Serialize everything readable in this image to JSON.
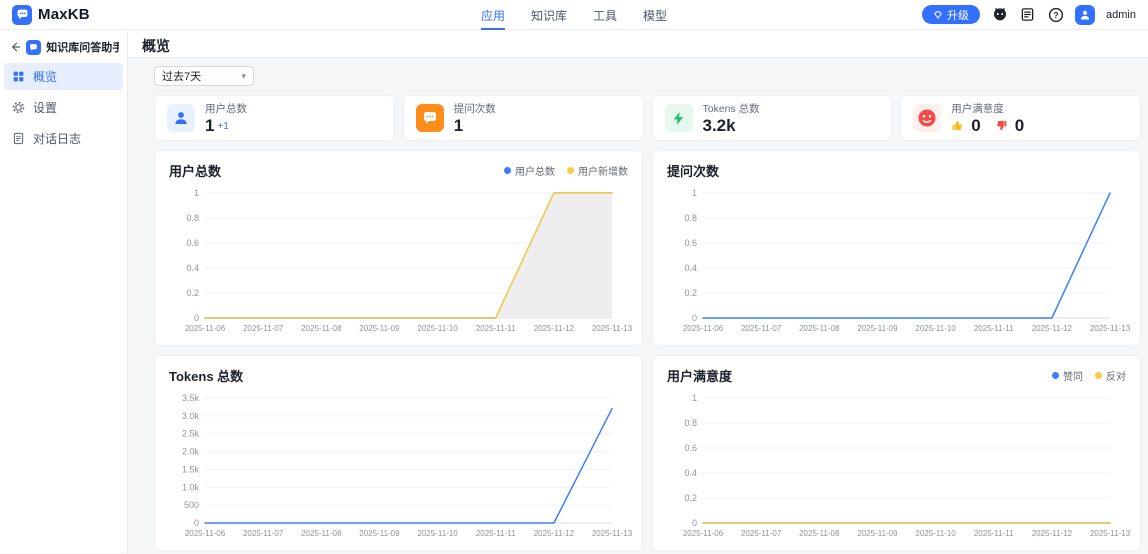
{
  "colors": {
    "accent": "#3370FF",
    "chart_blue": "#3D7EFF",
    "chart_yellow": "#F9CC45",
    "area_gray": "#ECECEC",
    "stat_orange": "#FF8D1A",
    "stat_green": "#1DBF6E",
    "stat_red": "#F54A45",
    "thumb_up_yellow": "#F7BA1E",
    "thumb_down_red": "#F54A45"
  },
  "topnav": {
    "logo_text": "MaxKB",
    "items": [
      {
        "label": "应用",
        "active": true
      },
      {
        "label": "知识库",
        "active": false
      },
      {
        "label": "工具",
        "active": false
      },
      {
        "label": "模型",
        "active": false
      }
    ],
    "upgrade_label": "升级",
    "username": "admin",
    "icons": [
      "gem-icon",
      "github-icon",
      "docs-icon",
      "help-icon",
      "user-avatar"
    ]
  },
  "sidebar": {
    "app_title": "知识库问答助手",
    "items": [
      {
        "label": "概览",
        "icon": "grid-icon",
        "active": true
      },
      {
        "label": "设置",
        "icon": "gear-icon",
        "active": false
      },
      {
        "label": "对话日志",
        "icon": "log-icon",
        "active": false
      }
    ]
  },
  "main": {
    "page_title": "概览",
    "filter_value": "过去7天",
    "stats": [
      {
        "label": "用户总数",
        "value": "1",
        "delta": "+1",
        "icon": "user-icon"
      },
      {
        "label": "提问次数",
        "value": "1",
        "icon": "chat-icon"
      },
      {
        "label": "Tokens 总数",
        "value": "3.2k",
        "icon": "token-icon"
      },
      {
        "label": "用户满意度",
        "up": "0",
        "down": "0",
        "icon": "face-icon"
      }
    ]
  },
  "chart_data": [
    {
      "type": "line",
      "title": "用户总数",
      "categories": [
        "2025-11-06",
        "2025-11-07",
        "2025-11-08",
        "2025-11-09",
        "2025-11-10",
        "2025-11-11",
        "2025-11-12",
        "2025-11-13"
      ],
      "ylim": [
        0,
        1
      ],
      "yticks": [
        0,
        0.2,
        0.4,
        0.6,
        0.8,
        1
      ],
      "ytick_labels": [
        "0",
        "0.2",
        "0.4",
        "0.6",
        "0.8",
        "1"
      ],
      "legend": true,
      "legend_position": "top-right",
      "grid": true,
      "series": [
        {
          "name": "用户总数",
          "color": "#3D7EFF",
          "values": [
            0,
            0,
            0,
            0,
            0,
            0,
            1,
            1
          ]
        },
        {
          "name": "用户新增数",
          "color": "#F9CC45",
          "values": [
            0,
            0,
            0,
            0,
            0,
            0,
            1,
            1
          ],
          "area": true,
          "area_color": "#ECECEC"
        }
      ]
    },
    {
      "type": "line",
      "title": "提问次数",
      "categories": [
        "2025-11-06",
        "2025-11-07",
        "2025-11-08",
        "2025-11-09",
        "2025-11-10",
        "2025-11-11",
        "2025-11-12",
        "2025-11-13"
      ],
      "ylim": [
        0,
        1
      ],
      "yticks": [
        0,
        0.2,
        0.4,
        0.6,
        0.8,
        1
      ],
      "ytick_labels": [
        "0",
        "0.2",
        "0.4",
        "0.6",
        "0.8",
        "1"
      ],
      "legend": false,
      "grid": true,
      "series": [
        {
          "name": "提问次数",
          "color": "#3D7EFF",
          "values": [
            0,
            0,
            0,
            0,
            0,
            0,
            0,
            1
          ]
        }
      ]
    },
    {
      "type": "line",
      "title": "Tokens 总数",
      "categories": [
        "2025-11-06",
        "2025-11-07",
        "2025-11-08",
        "2025-11-09",
        "2025-11-10",
        "2025-11-11",
        "2025-11-12",
        "2025-11-13"
      ],
      "ylim": [
        0,
        3500
      ],
      "yticks": [
        0,
        500,
        1000,
        1500,
        2000,
        2500,
        3000,
        3500
      ],
      "ytick_labels": [
        "0",
        "500",
        "1.0k",
        "1.5k",
        "2.0k",
        "2.5k",
        "3.0k",
        "3.5k"
      ],
      "legend": false,
      "grid": true,
      "series": [
        {
          "name": "Tokens 总数",
          "color": "#3D7EFF",
          "values": [
            0,
            0,
            0,
            0,
            0,
            0,
            0,
            3200
          ]
        }
      ]
    },
    {
      "type": "line",
      "title": "用户满意度",
      "categories": [
        "2025-11-06",
        "2025-11-07",
        "2025-11-08",
        "2025-11-09",
        "2025-11-10",
        "2025-11-11",
        "2025-11-12",
        "2025-11-13"
      ],
      "ylim": [
        0,
        1
      ],
      "yticks": [
        0,
        0.2,
        0.4,
        0.6,
        0.8,
        1
      ],
      "ytick_labels": [
        "0",
        "0.2",
        "0.4",
        "0.6",
        "0.8",
        "1"
      ],
      "legend": true,
      "legend_position": "top-right",
      "grid": true,
      "series": [
        {
          "name": "赞同",
          "color": "#3D7EFF",
          "values": [
            0,
            0,
            0,
            0,
            0,
            0,
            0,
            0
          ]
        },
        {
          "name": "反对",
          "color": "#F9CC45",
          "values": [
            0,
            0,
            0,
            0,
            0,
            0,
            0,
            0
          ]
        }
      ]
    }
  ]
}
